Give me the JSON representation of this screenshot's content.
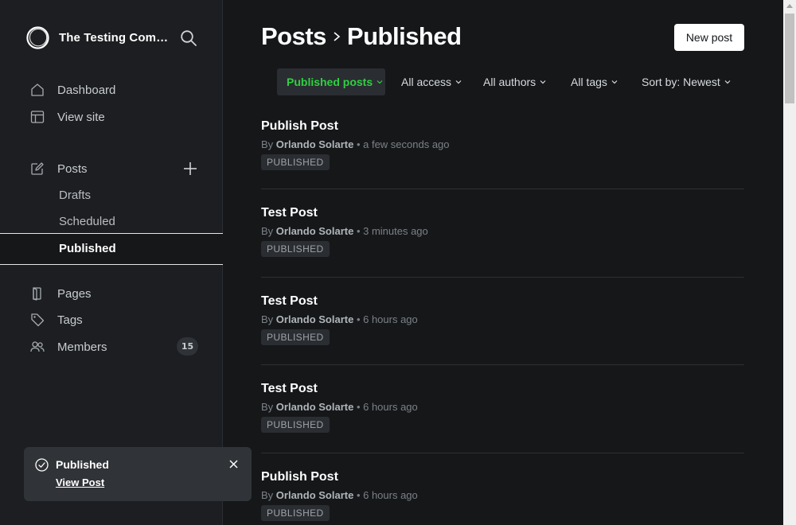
{
  "sidebar": {
    "site_name": "The Testing Community",
    "nav": [
      {
        "label": "Dashboard",
        "icon": "house-icon"
      },
      {
        "label": "View site",
        "icon": "layout-icon"
      },
      {
        "label": "Posts",
        "icon": "pencil-square-icon"
      },
      {
        "label": "Pages",
        "icon": "page-icon"
      },
      {
        "label": "Tags",
        "icon": "tag-icon"
      },
      {
        "label": "Members",
        "icon": "members-icon",
        "count": "15"
      }
    ],
    "post_subitems": [
      "Drafts",
      "Scheduled",
      "Published"
    ],
    "active_subitem": "Published"
  },
  "toast": {
    "title": "Published",
    "link": "View Post"
  },
  "header": {
    "title_parent": "Posts",
    "title_current": "Published",
    "new_post_label": "New post"
  },
  "filters": [
    {
      "label": "Published posts",
      "active": true
    },
    {
      "label": "All access",
      "active": false
    },
    {
      "label": "All authors",
      "active": false
    },
    {
      "label": "All tags",
      "active": false
    },
    {
      "label": "Sort by: Newest",
      "active": false
    }
  ],
  "posts": [
    {
      "title": "Publish Post",
      "by": "By",
      "author": "Orlando Solarte",
      "time": "a few seconds ago",
      "status": "PUBLISHED"
    },
    {
      "title": "Test Post",
      "by": "By",
      "author": "Orlando Solarte",
      "time": "3 minutes ago",
      "status": "PUBLISHED"
    },
    {
      "title": "Test Post",
      "by": "By",
      "author": "Orlando Solarte",
      "time": "6 hours ago",
      "status": "PUBLISHED"
    },
    {
      "title": "Test Post",
      "by": "By",
      "author": "Orlando Solarte",
      "time": "6 hours ago",
      "status": "PUBLISHED"
    },
    {
      "title": "Publish Post",
      "by": "By",
      "author": "Orlando Solarte",
      "time": "6 hours ago",
      "status": "PUBLISHED"
    }
  ],
  "colors": {
    "background": "#151719",
    "sidebar": "#1c1e21",
    "accent_green": "#30cf43",
    "text_primary": "#ffffff"
  }
}
